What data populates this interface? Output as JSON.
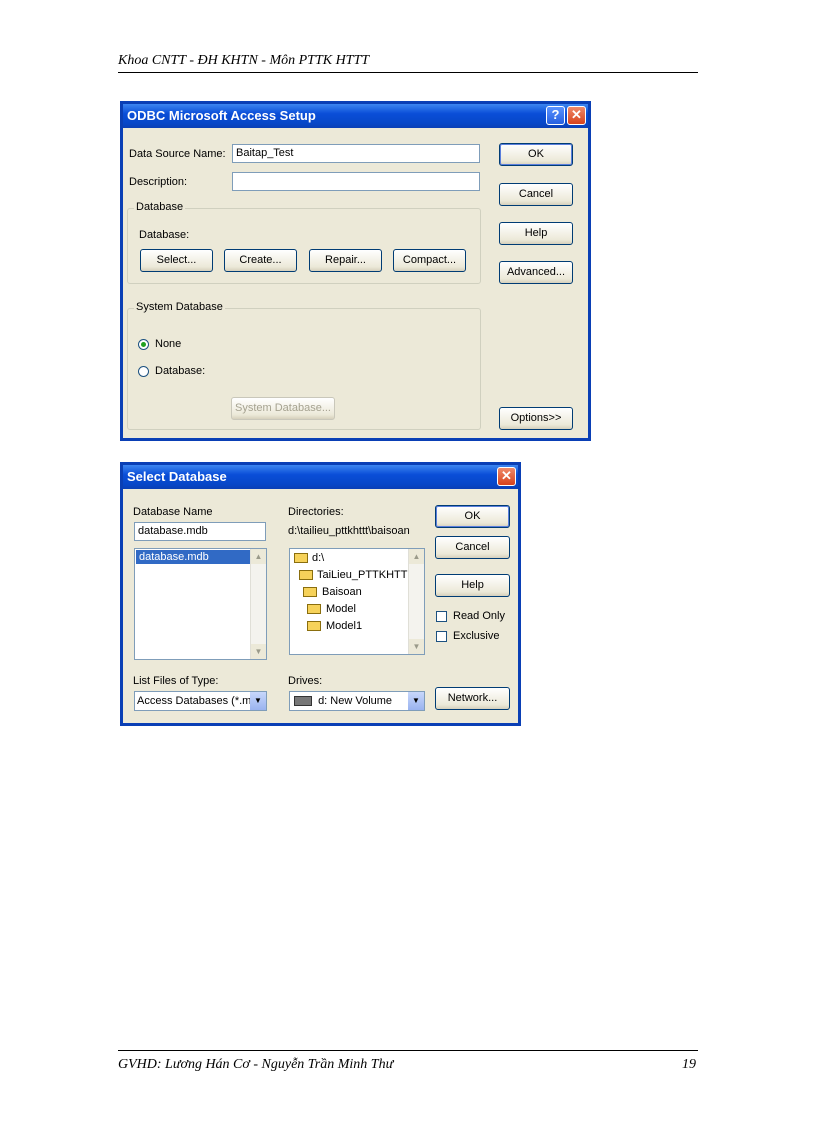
{
  "header": {
    "text": "Khoa CNTT - ĐH KHTN - Môn  PTTK HTTT"
  },
  "footer": {
    "author": "GVHD:  Lương Hán Cơ  - Nguyễn Trần Minh Thư",
    "page_number": "19"
  },
  "odbc_dialog": {
    "title": "ODBC Microsoft Access Setup",
    "data_source_name_label": "Data Source Name:",
    "data_source_name_value": "Baitap_Test",
    "description_label": "Description:",
    "description_value": "",
    "database_group": "Database",
    "database_label": "Database:",
    "select_btn": "Select...",
    "create_btn": "Create...",
    "repair_btn": "Repair...",
    "compact_btn": "Compact...",
    "system_db_group": "System Database",
    "none_label": "None",
    "database_radio_label": "Database:",
    "system_database_btn": "System Database...",
    "ok_btn": "OK",
    "cancel_btn": "Cancel",
    "help_btn": "Help",
    "advanced_btn": "Advanced...",
    "options_btn": "Options>>"
  },
  "select_dialog": {
    "title": "Select Database",
    "database_name_label": "Database Name",
    "database_name_value": "database.mdb",
    "files": [
      "database.mdb"
    ],
    "directories_label": "Directories:",
    "current_dir": "d:\\tailieu_pttkhttt\\baisoan",
    "dir_tree": [
      "d:\\",
      "TaiLieu_PTTKHTT",
      "Baisoan",
      "Model",
      "Model1"
    ],
    "list_type_label": "List Files of Type:",
    "list_type_value": "Access Databases (*.m",
    "drives_label": "Drives:",
    "drive_value": "d: New Volume",
    "ok_btn": "OK",
    "cancel_btn": "Cancel",
    "help_btn": "Help",
    "read_only_label": "Read Only",
    "exclusive_label": "Exclusive",
    "network_btn": "Network..."
  }
}
